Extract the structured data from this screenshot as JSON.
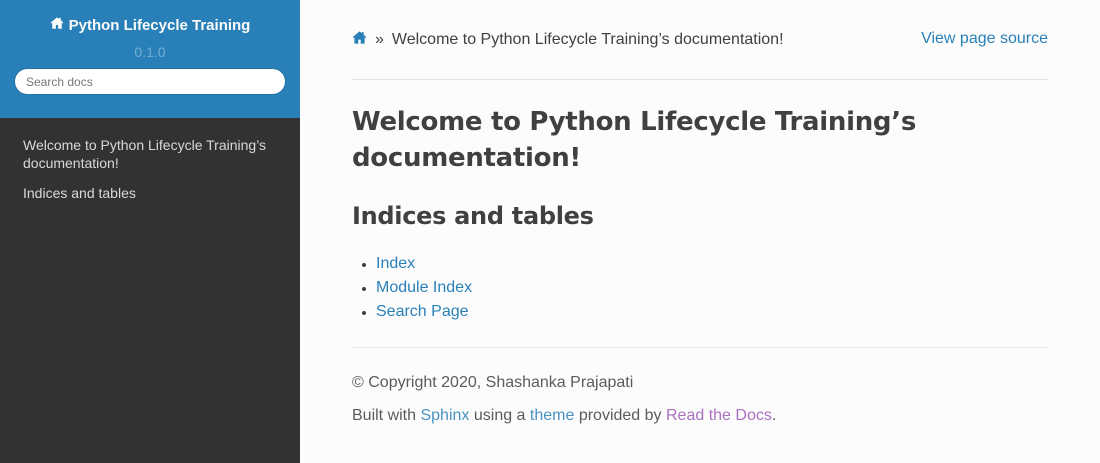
{
  "sidebar": {
    "project_title": "Python Lifecycle Training",
    "version": "0.1.0",
    "search_placeholder": "Search docs",
    "menu": [
      {
        "label": "Welcome to Python Lifecycle Training’s documentation!"
      },
      {
        "label": "Indices and tables"
      }
    ]
  },
  "breadcrumbs": {
    "separator": "»",
    "current": "Welcome to Python Lifecycle Training’s documentation!",
    "view_source": "View page source"
  },
  "main": {
    "title": "Welcome to Python Lifecycle Training’s documentation!",
    "section_title": "Indices and tables",
    "links": [
      {
        "label": "Index"
      },
      {
        "label": "Module Index"
      },
      {
        "label": "Search Page"
      }
    ]
  },
  "footer": {
    "copyright": "© Copyright 2020, Shashanka Prajapati",
    "built_with": "Built with",
    "sphinx": "Sphinx",
    "using_a": "using a",
    "theme": "theme",
    "provided_by": "provided by",
    "rtd": "Read the Docs",
    "period": "."
  },
  "colors": {
    "accent": "#2980b9",
    "sidebar_bg": "#343131",
    "link_visited": "#9b59b6"
  }
}
